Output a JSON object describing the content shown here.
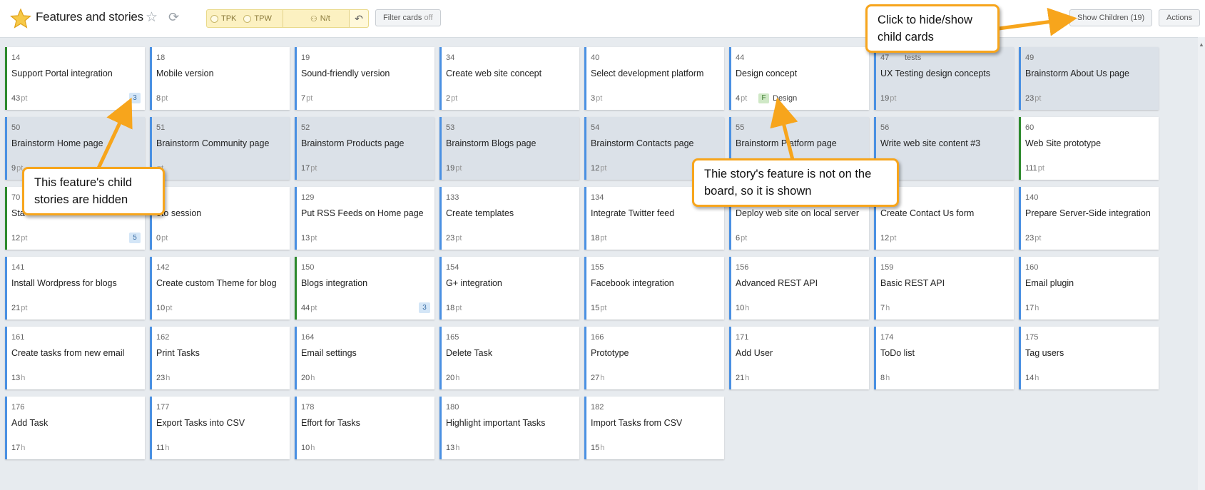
{
  "header": {
    "title": "Features and stories",
    "tpk_label": "TPK",
    "tpw_label": "TPW",
    "nt_label": "N/t",
    "filter_label": "Filter cards",
    "filter_state": "off",
    "show_children_label": "Show Children (19)",
    "actions_label": "Actions"
  },
  "colors": {
    "feature_border": "#2d8a2d",
    "story_border": "#4a90e2",
    "callout_border": "#f7a51c",
    "grey_card": "#dbe1e8"
  },
  "icons": [
    "star-logo-icon",
    "favorite-star-icon",
    "refresh-icon",
    "team-icon",
    "undo-icon",
    "scroll-up-icon"
  ],
  "cards": [
    {
      "id": "14",
      "name": "Support Portal integration",
      "effort": "43",
      "unit": "pt",
      "count": "3",
      "type": "feature"
    },
    {
      "id": "18",
      "name": "Mobile version",
      "effort": "8",
      "unit": "pt",
      "type": "story"
    },
    {
      "id": "19",
      "name": "Sound-friendly version",
      "effort": "7",
      "unit": "pt",
      "type": "story"
    },
    {
      "id": "34",
      "name": "Create web site concept",
      "effort": "2",
      "unit": "pt",
      "type": "story"
    },
    {
      "id": "40",
      "name": "Select development platform",
      "effort": "3",
      "unit": "pt",
      "type": "story"
    },
    {
      "id": "44",
      "name": "Design concept",
      "effort": "4",
      "unit": "pt",
      "type": "story",
      "feature_badge": "F",
      "feature_name": "Design"
    },
    {
      "id": "47",
      "tag": "tests",
      "name": "UX Testing design concepts",
      "effort": "19",
      "unit": "pt",
      "type": "story",
      "grey": true
    },
    {
      "id": "49",
      "name": "Brainstorm About Us page",
      "effort": "23",
      "unit": "pt",
      "type": "story",
      "grey": true
    },
    {
      "id": "50",
      "name": "Brainstorm Home page",
      "effort": "9",
      "unit": "pt",
      "type": "story",
      "grey": true
    },
    {
      "id": "51",
      "name": "Brainstorm Community page",
      "effort": "",
      "unit": "pt",
      "type": "story",
      "grey": true
    },
    {
      "id": "52",
      "name": "Brainstorm Products page",
      "effort": "17",
      "unit": "pt",
      "type": "story",
      "grey": true
    },
    {
      "id": "53",
      "name": "Brainstorm Blogs page",
      "effort": "19",
      "unit": "pt",
      "type": "story",
      "grey": true
    },
    {
      "id": "54",
      "name": "Brainstorm Contacts page",
      "effort": "12",
      "unit": "pt",
      "type": "story",
      "grey": true
    },
    {
      "id": "55",
      "name": "Brainstorm Platform page",
      "effort": "",
      "unit": "",
      "type": "story",
      "grey": true
    },
    {
      "id": "56",
      "name": "Write web site content #3",
      "effort": "",
      "unit": "",
      "type": "story",
      "grey": true
    },
    {
      "id": "60",
      "name": "Web Site prototype",
      "effort": "111",
      "unit": "pt",
      "type": "feature"
    },
    {
      "id": "70",
      "name": "Sta",
      "effort": "12",
      "unit": "pt",
      "count": "5",
      "type": "feature"
    },
    {
      "id": "5",
      "name": "oto session",
      "effort": "0",
      "unit": "pt",
      "type": "story"
    },
    {
      "id": "129",
      "name": "Put RSS Feeds on Home page",
      "effort": "13",
      "unit": "pt",
      "type": "story"
    },
    {
      "id": "133",
      "name": "Create templates",
      "effort": "23",
      "unit": "pt",
      "type": "story"
    },
    {
      "id": "134",
      "name": "Integrate Twitter feed",
      "effort": "18",
      "unit": "pt",
      "type": "story"
    },
    {
      "id": "",
      "name": "Deploy web site on local server",
      "effort": "6",
      "unit": "pt",
      "type": "story"
    },
    {
      "id": "",
      "name": "Create Contact Us form",
      "effort": "12",
      "unit": "pt",
      "type": "story"
    },
    {
      "id": "140",
      "name": "Prepare Server-Side integration",
      "effort": "23",
      "unit": "pt",
      "type": "story"
    },
    {
      "id": "141",
      "name": "Install Wordpress for blogs",
      "effort": "21",
      "unit": "pt",
      "type": "story"
    },
    {
      "id": "142",
      "name": "Create custom Theme for blog",
      "effort": "10",
      "unit": "pt",
      "type": "story"
    },
    {
      "id": "150",
      "name": "Blogs integration",
      "effort": "44",
      "unit": "pt",
      "count": "3",
      "type": "feature"
    },
    {
      "id": "154",
      "name": "G+ integration",
      "effort": "18",
      "unit": "pt",
      "type": "story"
    },
    {
      "id": "155",
      "name": "Facebook integration",
      "effort": "15",
      "unit": "pt",
      "type": "story"
    },
    {
      "id": "156",
      "name": "Advanced REST API",
      "effort": "10",
      "unit": "h",
      "type": "story"
    },
    {
      "id": "159",
      "name": "Basic REST API",
      "effort": "7",
      "unit": "h",
      "type": "story"
    },
    {
      "id": "160",
      "name": "Email plugin",
      "effort": "17",
      "unit": "h",
      "type": "story"
    },
    {
      "id": "161",
      "name": "Create tasks from new email",
      "effort": "13",
      "unit": "h",
      "type": "story"
    },
    {
      "id": "162",
      "name": "Print Tasks",
      "effort": "23",
      "unit": "h",
      "type": "story"
    },
    {
      "id": "164",
      "name": "Email settings",
      "effort": "20",
      "unit": "h",
      "type": "story"
    },
    {
      "id": "165",
      "name": "Delete Task",
      "effort": "20",
      "unit": "h",
      "type": "story"
    },
    {
      "id": "166",
      "name": "Prototype",
      "effort": "27",
      "unit": "h",
      "type": "story"
    },
    {
      "id": "171",
      "name": "Add User",
      "effort": "21",
      "unit": "h",
      "type": "story"
    },
    {
      "id": "174",
      "name": "ToDo list",
      "effort": "8",
      "unit": "h",
      "type": "story"
    },
    {
      "id": "175",
      "name": "Tag users",
      "effort": "14",
      "unit": "h",
      "type": "story"
    },
    {
      "id": "176",
      "name": "Add Task",
      "effort": "17",
      "unit": "h",
      "type": "story"
    },
    {
      "id": "177",
      "name": "Export Tasks into CSV",
      "effort": "11",
      "unit": "h",
      "type": "story"
    },
    {
      "id": "178",
      "name": "Effort for Tasks",
      "effort": "10",
      "unit": "h",
      "type": "story"
    },
    {
      "id": "180",
      "name": "Highlight important Tasks",
      "effort": "13",
      "unit": "h",
      "type": "story"
    },
    {
      "id": "182",
      "name": "Import Tasks from CSV",
      "effort": "15",
      "unit": "h",
      "type": "story"
    }
  ],
  "callouts": {
    "show_children": "Click to hide/show child cards",
    "feature_hidden": "This feature's child stories are hidden",
    "story_feature": "Thie story's feature is not on the board, so it is shown"
  }
}
